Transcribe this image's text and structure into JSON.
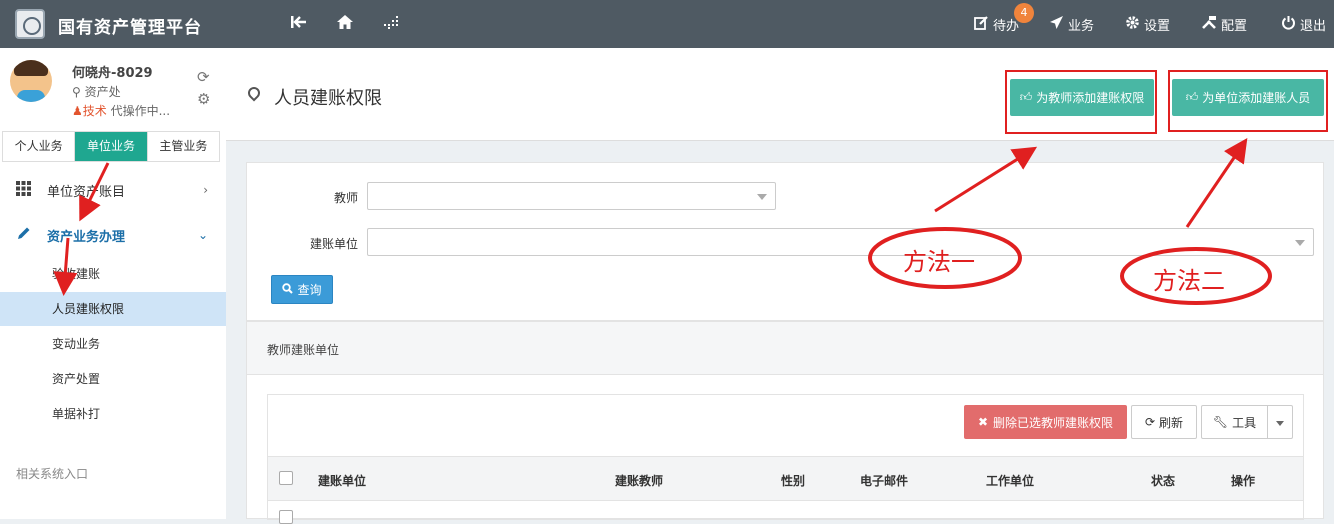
{
  "app": {
    "title": "国有资产管理平台"
  },
  "topbar": {
    "todo_label": "待办",
    "todo_badge": "4",
    "business_label": "业务",
    "settings_label": "设置",
    "config_label": "配置",
    "logout_label": "退出"
  },
  "user": {
    "name": "何晓舟-8029",
    "dept": "资产处",
    "role_tag": "技术",
    "role_text": "代操作中..."
  },
  "sidebar": {
    "tabs": [
      {
        "label": "个人业务"
      },
      {
        "label": "单位业务",
        "active": true
      },
      {
        "label": "主管业务"
      }
    ],
    "menu": [
      {
        "label": "单位资产账目",
        "icon": "grid-icon"
      },
      {
        "label": "资产业务办理",
        "icon": "pencil-icon",
        "open": true
      }
    ],
    "submenu": [
      {
        "label": "验收建账"
      },
      {
        "label": "人员建账权限",
        "active": true
      },
      {
        "label": "变动业务"
      },
      {
        "label": "资产处置"
      },
      {
        "label": "单据补打"
      }
    ],
    "related_label": "相关系统入口"
  },
  "header": {
    "title": "人员建账权限",
    "btn_teacher": "为教师添加建账权限",
    "btn_unit": "为单位添加建账人员"
  },
  "filter": {
    "teacher_label": "教师",
    "unit_label": "建账单位",
    "query_label": "查询"
  },
  "panel": {
    "title": "教师建账单位",
    "delete_label": "删除已选教师建账权限",
    "refresh_label": "刷新",
    "tools_label": "工具",
    "columns": [
      "建账单位",
      "建账教师",
      "性别",
      "电子邮件",
      "工作单位",
      "状态",
      "操作"
    ]
  },
  "annotations": {
    "method1": "方法一",
    "method2": "方法二",
    "color": "#e02020"
  },
  "colors": {
    "topbar": "#4f5a63",
    "accent_green": "#49b7a4",
    "tab_active": "#1fa790",
    "query_blue": "#3b9bd8",
    "delete_red": "#e26c6c"
  }
}
